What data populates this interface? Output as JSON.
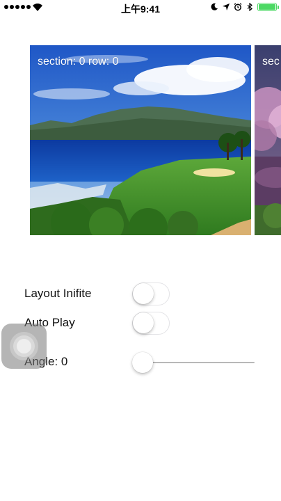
{
  "status_bar": {
    "time": "上午9:41",
    "signal_bars": 5,
    "battery_level": 1.0,
    "icons": [
      "signal-dots-icon",
      "wifi-icon",
      "moon-icon",
      "location-arrow-icon",
      "alarm-clock-icon",
      "bluetooth-icon",
      "battery-charging-icon"
    ],
    "battery_color": "#4cd964"
  },
  "carousel": {
    "cards": [
      {
        "caption": "section: 0 row: 0",
        "image": "tropical-coast-golf-course"
      },
      {
        "caption": "sec",
        "image": "pink-blossom-lake"
      }
    ]
  },
  "controls": {
    "layout_infinite": {
      "label": "Layout Inifite",
      "on": false
    },
    "auto_play": {
      "label": "Auto Play",
      "on": false
    },
    "angle": {
      "label": "Angle: 0",
      "value": 0
    }
  },
  "colors": {
    "toggle_border": "#e3e3e6",
    "slider_track": "#b8b8b8",
    "background": "#ffffff"
  }
}
